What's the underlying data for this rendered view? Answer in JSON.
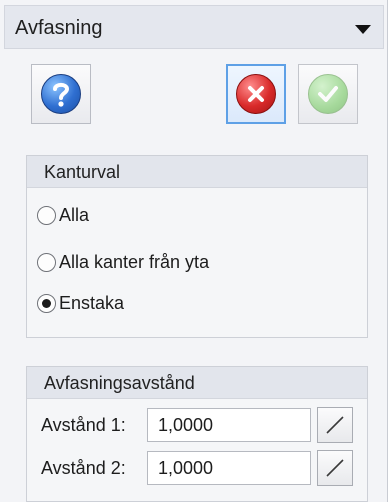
{
  "panel": {
    "title": "Avfasning",
    "collapse_icon": "chevron-down-icon"
  },
  "buttons": {
    "help_icon": "help-icon",
    "cancel_icon": "cancel-icon",
    "ok_icon": "checkmark-icon"
  },
  "edge_selection": {
    "title": "Kanturval",
    "options": [
      {
        "label": "Alla",
        "selected": false
      },
      {
        "label": "Alla kanter från yta",
        "selected": false
      },
      {
        "label": "Enstaka",
        "selected": true
      }
    ]
  },
  "chamfer_distance": {
    "title": "Avfasningsavstånd",
    "fields": [
      {
        "label": "Avstånd 1:",
        "value": "1,0000",
        "pick_icon": "measure-line-icon"
      },
      {
        "label": "Avstånd 2:",
        "value": "1,0000",
        "pick_icon": "measure-line-icon"
      }
    ]
  },
  "colors": {
    "accent_focus": "#5ea0e6",
    "help_blue": "#2f6fd1",
    "cancel_red": "#d92a2a",
    "ok_green": "#8ed27f"
  }
}
